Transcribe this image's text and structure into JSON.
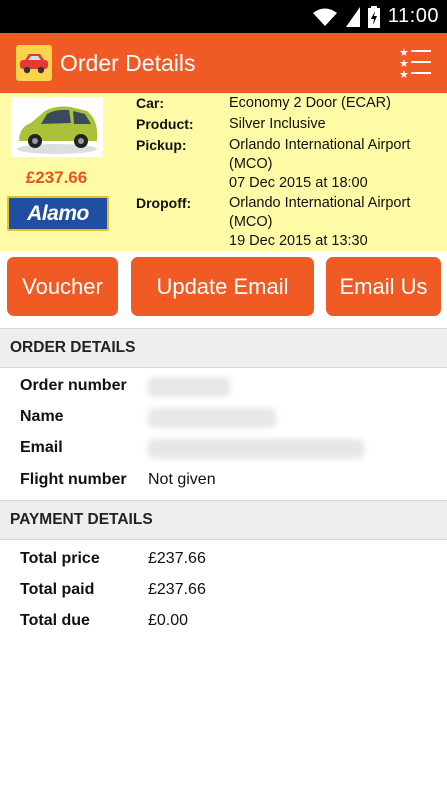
{
  "status_bar": {
    "time": "11:00"
  },
  "app_bar": {
    "title": "Order Details"
  },
  "summary": {
    "price": "£237.66",
    "brand": "Alamo",
    "fields": [
      {
        "label": "Car:",
        "value": "Economy 2 Door (ECAR)"
      },
      {
        "label": "Product:",
        "value": "Silver Inclusive"
      },
      {
        "label": "Pickup:",
        "value_line1": "Orlando International Airport",
        "value_line2": "(MCO)",
        "value_line3": "07 Dec 2015 at 18:00"
      },
      {
        "label": "Dropoff:",
        "value_line1": "Orlando International Airport",
        "value_line2": "(MCO)",
        "value_line3": "19 Dec 2015 at 13:30"
      }
    ]
  },
  "buttons": {
    "voucher": "Voucher",
    "update_email": "Update Email",
    "email_us": "Email Us"
  },
  "order_details": {
    "header": "ORDER DETAILS",
    "order_number_label": "Order number",
    "name_label": "Name",
    "email_label": "Email",
    "flight_number_label": "Flight number",
    "flight_number_value": "Not given"
  },
  "payment_details": {
    "header": "PAYMENT DETAILS",
    "total_price_label": "Total price",
    "total_price_value": "£237.66",
    "total_paid_label": "Total paid",
    "total_paid_value": "£237.66",
    "total_due_label": "Total due",
    "total_due_value": "£0.00"
  },
  "colors": {
    "accent": "#f05a24",
    "summary_bg": "#fffaa6",
    "price": "#e8541c"
  }
}
